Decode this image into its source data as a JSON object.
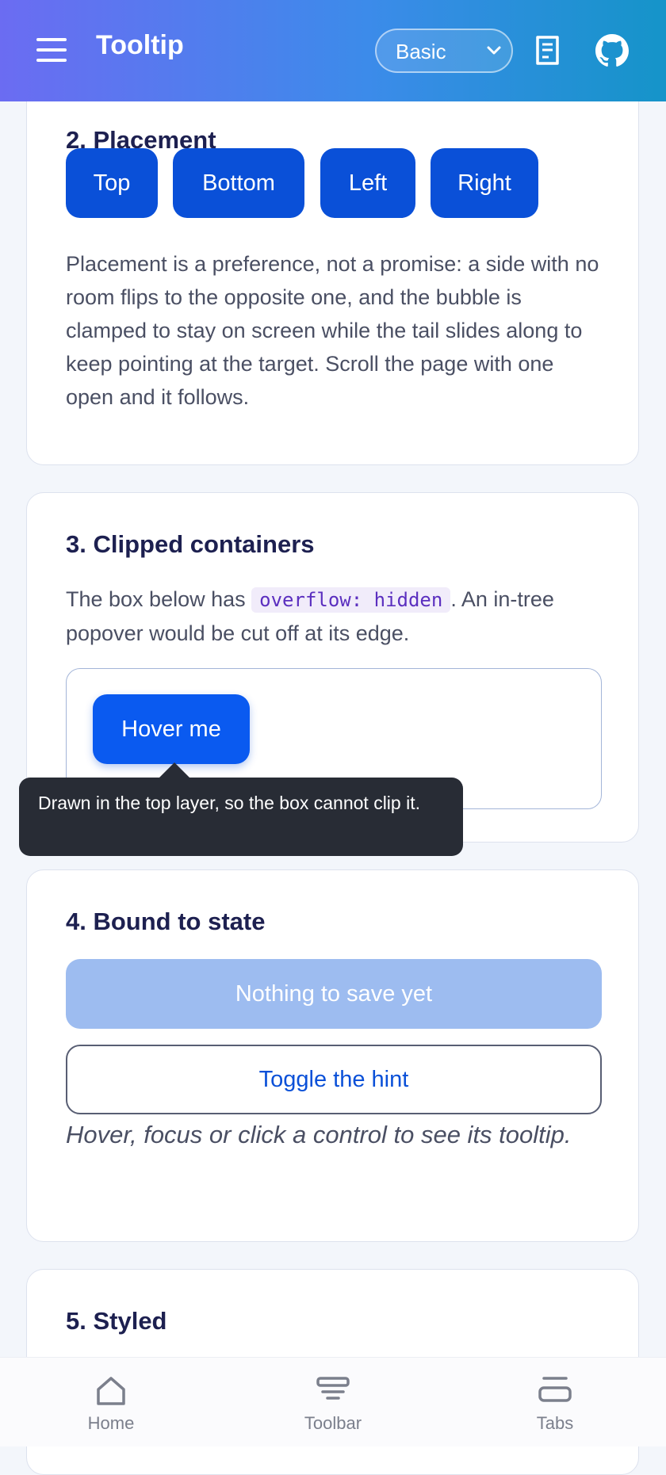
{
  "header": {
    "title": "Tooltip",
    "mode_select": {
      "selected": "Basic"
    },
    "menu_icon": "hamburger-menu-icon",
    "docs_icon": "docs-icon",
    "github_icon": "github-icon"
  },
  "sections": {
    "placement": {
      "title": "2. Placement",
      "buttons": [
        "Top",
        "Bottom",
        "Left",
        "Right"
      ],
      "description": "Placement is a preference, not a promise: a side with no room flips to the opposite one, and the bubble is clamped to stay on screen while the tail slides along to keep pointing at the target. Scroll the page with one open and it follows."
    },
    "clipped": {
      "title": "3. Clipped containers",
      "desc_before": "The box below has ",
      "code": "overflow: hidden",
      "desc_after": ". An in-tree popover would be cut off at its edge.",
      "hover_button": "Hover me",
      "tooltip": "Drawn in the top layer, so the box cannot clip it."
    },
    "bound": {
      "title": "4. Bound to state",
      "save_button": "Nothing to save yet",
      "toggle_button": "Toggle the hint",
      "hint": "Hover, focus or click a control to see its tooltip."
    },
    "styled": {
      "title": "5. Styled"
    }
  },
  "bottom_nav": [
    {
      "label": "Home",
      "icon": "home-icon"
    },
    {
      "label": "Toolbar",
      "icon": "toolbar-icon"
    },
    {
      "label": "Tabs",
      "icon": "tabs-icon"
    }
  ],
  "colors": {
    "primary": "#0a50d8",
    "tooltip_bg": "#282c35",
    "disabled": "#9dbcf0"
  }
}
